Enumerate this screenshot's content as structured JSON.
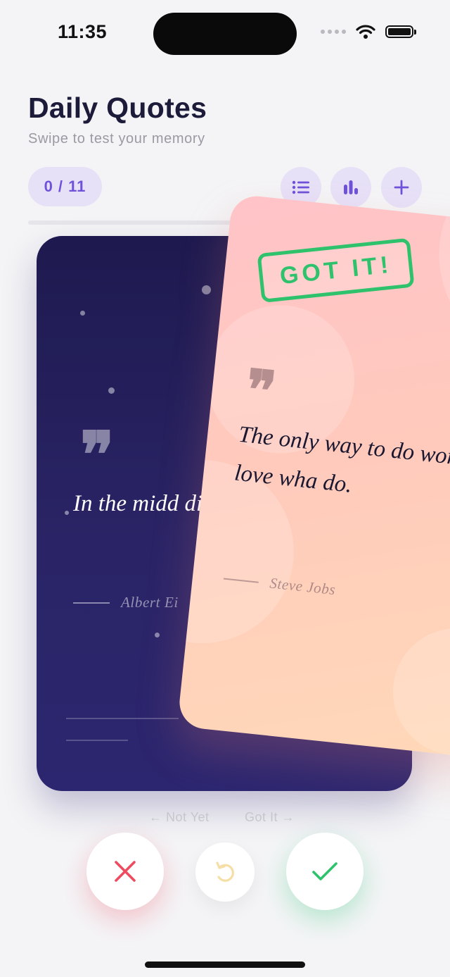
{
  "status_bar": {
    "time": "11:35"
  },
  "header": {
    "title": "Daily Quotes",
    "subtitle": "Swipe to test your memory"
  },
  "toolbar": {
    "counter": "0 / 11",
    "buttons": [
      {
        "icon": "list-icon"
      },
      {
        "icon": "bar-chart-icon"
      },
      {
        "icon": "plus-icon"
      }
    ]
  },
  "progress": {
    "value": 0,
    "total": 11
  },
  "cards": {
    "back": {
      "quote_mark": "❞",
      "quote": "In the midd difficulty li",
      "author": "Albert Ei"
    },
    "front": {
      "stamp": "GOT IT!",
      "quote_mark": "❞",
      "quote": "The only way to do work is to love wha do.",
      "author": "Steve Jobs"
    }
  },
  "hints": {
    "left": "← Not Yet",
    "right": "Got It →"
  },
  "actions": {
    "reject": {
      "icon": "x-icon",
      "color": "#ef4a5f"
    },
    "undo": {
      "icon": "undo-icon",
      "color": "#f5dfa6"
    },
    "accept": {
      "icon": "check-icon",
      "color": "#2fc26c"
    }
  },
  "colors": {
    "accent": "#6f52d9",
    "accent_bg": "#e7e1f8",
    "card_dark": "#231e5a",
    "stamp": "#2fc26c"
  }
}
